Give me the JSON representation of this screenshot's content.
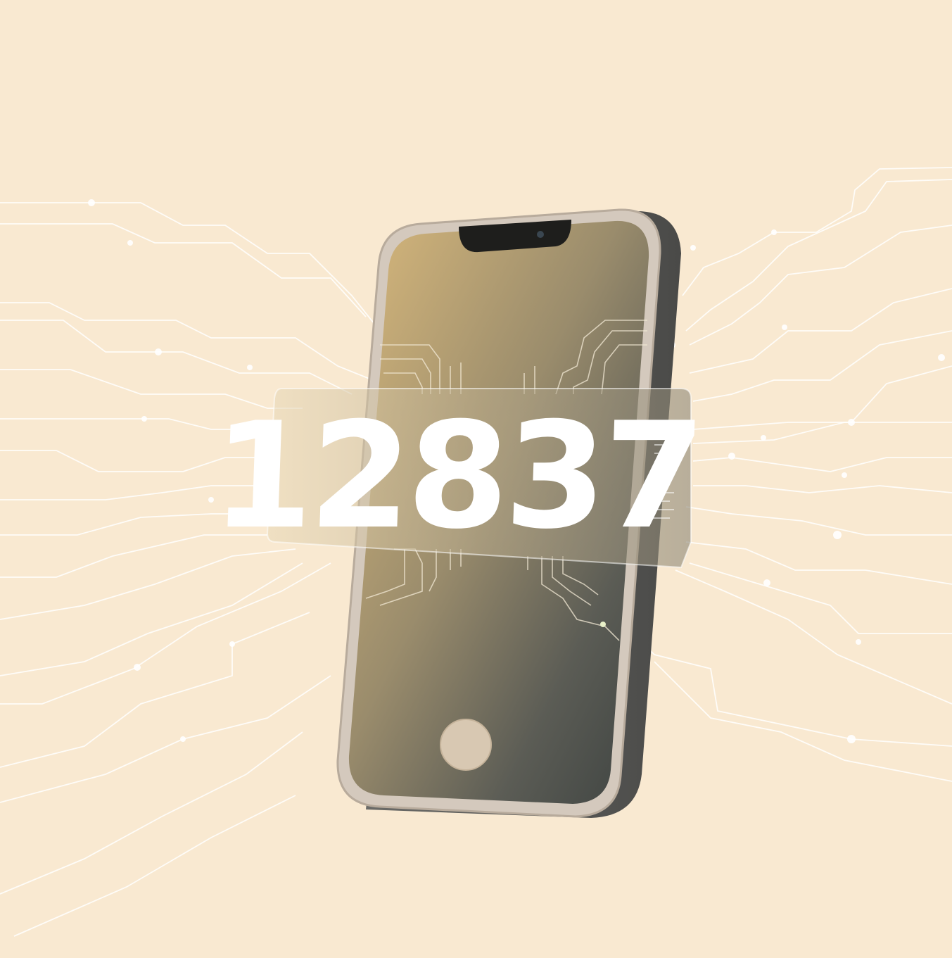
{
  "illustration": {
    "code": "12837"
  },
  "colors": {
    "background": "#f9e9d1",
    "circuit": "#ffffff",
    "phone_frame": "#cfc4b8",
    "phone_side": "#5a5a5a",
    "screen_top": "#d7b679",
    "screen_bottom": "#3f4340",
    "home_button": "#d8c8b2",
    "code_text": "#ffffff"
  },
  "icons": {
    "device": "smartphone-icon",
    "camera": "front-camera-icon",
    "home": "home-button-icon"
  }
}
